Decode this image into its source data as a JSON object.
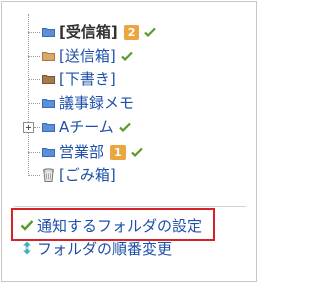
{
  "folders": [
    {
      "label": "[受信箱]",
      "badge": "2",
      "checked": true,
      "selected": true,
      "icon": "folder-blue-icon"
    },
    {
      "label": "[送信箱]",
      "badge": "",
      "checked": true,
      "selected": false,
      "icon": "folder-tan-icon"
    },
    {
      "label": "[下書き]",
      "badge": "",
      "checked": false,
      "selected": false,
      "icon": "folder-brown-icon"
    },
    {
      "label": "議事録メモ",
      "badge": "",
      "checked": false,
      "selected": false,
      "icon": "folder-blue-icon"
    },
    {
      "label": "Aチーム",
      "badge": "",
      "checked": true,
      "selected": false,
      "icon": "folder-blue-icon",
      "expandable": true
    },
    {
      "label": "営業部",
      "badge": "1",
      "checked": true,
      "selected": false,
      "icon": "folder-blue-icon"
    },
    {
      "label": "[ごみ箱]",
      "badge": "",
      "checked": false,
      "selected": false,
      "icon": "trash-icon"
    }
  ],
  "actions": {
    "notify_settings": "通知するフォルダの設定",
    "reorder_folders": "フォルダの順番変更"
  },
  "colors": {
    "link": "#1d4fa8",
    "badge": "#e9a641",
    "check": "#5a9a2a",
    "highlight": "#d6232a"
  }
}
